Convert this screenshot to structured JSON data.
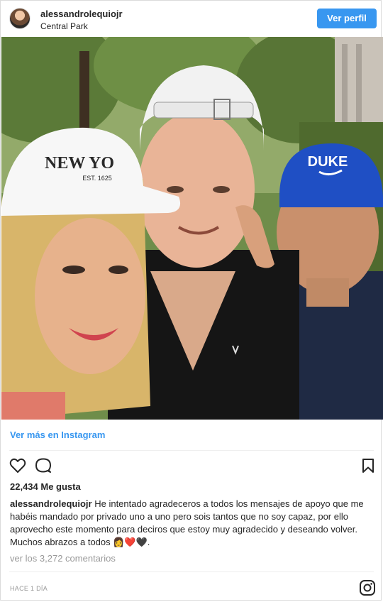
{
  "header": {
    "username": "alessandrolequiojr",
    "location": "Central Park",
    "profile_button": "Ver perfil"
  },
  "photo": {
    "cap_left_text": "NEW YO",
    "cap_left_sub": "EST. 1625",
    "cap_right_text": "DUKE"
  },
  "view_more": "Ver más en Instagram",
  "actions": {
    "like_icon": "heart-icon",
    "comment_icon": "comment-icon",
    "save_icon": "bookmark-icon"
  },
  "likes": "22,434 Me gusta",
  "caption": {
    "user": "alessandrolequiojr",
    "text": "He intentado agradeceros a todos los mensajes de apoyo que me habéis mandado por privado uno a uno pero sois tantos que no soy capaz, por ello aprovecho este momento para deciros que estoy muy agradecido y deseando volver. Muchos abrazos a todos 👩‍❤️🖤."
  },
  "comments_link": "ver los 3,272 comentarios",
  "timestamp": "HACE 1 DÍA",
  "footer_icon": "instagram-logo-icon",
  "colors": {
    "link": "#3897f0",
    "button_bg": "#3897f0",
    "muted": "#999999"
  }
}
